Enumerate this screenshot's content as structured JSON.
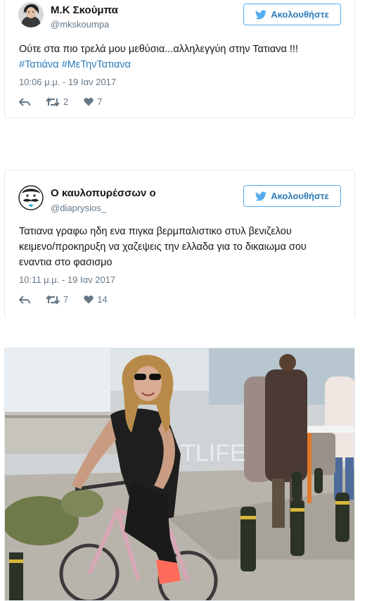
{
  "tweets": [
    {
      "name": "Μ.Κ Σκούμπα",
      "handle": "@mkskoumpa",
      "follow_label": "Ακολουθήστε",
      "text": "Ούτε στα πιο τρελά μου μεθύσια...αλληλεγγύη στην Τατιανα !!!",
      "hashtags": [
        "#Τατιάνα",
        "#ΜεΤηνΤατιανα"
      ],
      "date": "10:06 μ.μ. - 19 Ιαν 2017",
      "retweets": "2",
      "likes": "7",
      "avatar_icon": "profile-photo"
    },
    {
      "name": "Ο καυλοπυρέσσων ο",
      "handle": "@diaprysios_",
      "follow_label": "Ακολουθήστε",
      "text_lines": [
        "Τατιανα γραφω ηδη ενα πιγκα βερμπαλιστικο στυλ βενιζελου",
        "κειμενο/προκηρυξη να χαζεψεις την ελλαδα για το δικαιωμα σου",
        "εναντια στο φασισμο"
      ],
      "date": "10:11 μ.μ. - 19 Ιαν 2017",
      "retweets": "7",
      "likes": "14",
      "avatar_icon": "mustache-face-icon"
    }
  ],
  "photo": {
    "watermark": "TLIFE",
    "description_icon": "woman-on-bicycle-photo"
  },
  "colors": {
    "link": "#2b7bb9",
    "follow_border": "#55acee",
    "muted": "#657786"
  }
}
